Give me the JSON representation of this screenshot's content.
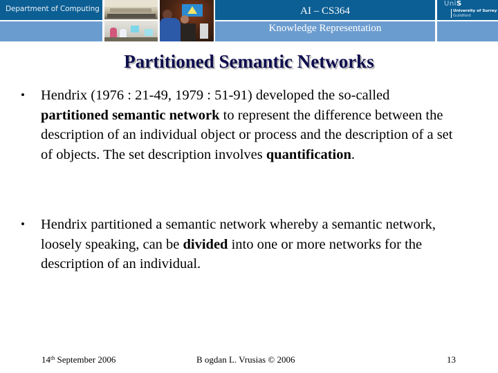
{
  "header": {
    "department": "Department of Computing",
    "course_code": "AI – CS364",
    "course_name": "Knowledge Representation",
    "logo": {
      "brand_prefix": "Uni",
      "brand_suffix": "S",
      "university": "University of Surrey",
      "location": "Guildford"
    },
    "photos": [
      "computer-lab-photo",
      "students-at-computers-photo",
      "students-presentation-photo"
    ],
    "colors": {
      "dark_band": "#0c5f94",
      "light_band": "#6b9ccf",
      "title_text": "#0d0d4d"
    }
  },
  "slide": {
    "title": "Partitioned Semantic Networks",
    "bullets": [
      {
        "segments": [
          {
            "text": "Hendrix (1976 : 21-49, 1979 : 51-91) developed the so-called ",
            "bold": false
          },
          {
            "text": "partitioned semantic network",
            "bold": true
          },
          {
            "text": " to represent the difference between the description of an individual object or process and the description of a set of objects. The set description involves ",
            "bold": false
          },
          {
            "text": "quantification",
            "bold": true
          },
          {
            "text": ".",
            "bold": false
          }
        ]
      },
      {
        "segments": [
          {
            "text": "Hendrix partitioned a semantic network whereby a semantic network, loosely speaking, can be ",
            "bold": false
          },
          {
            "text": "divided",
            "bold": true
          },
          {
            "text": " into one or more networks for the description of an individual.",
            "bold": false
          }
        ]
      }
    ],
    "bullet_glyph": "•"
  },
  "footer": {
    "date_day": "14",
    "date_suffix": "th",
    "date_rest": " September 2006",
    "author": "B ogdan L. Vrusias © 2006",
    "page_number": "13"
  }
}
